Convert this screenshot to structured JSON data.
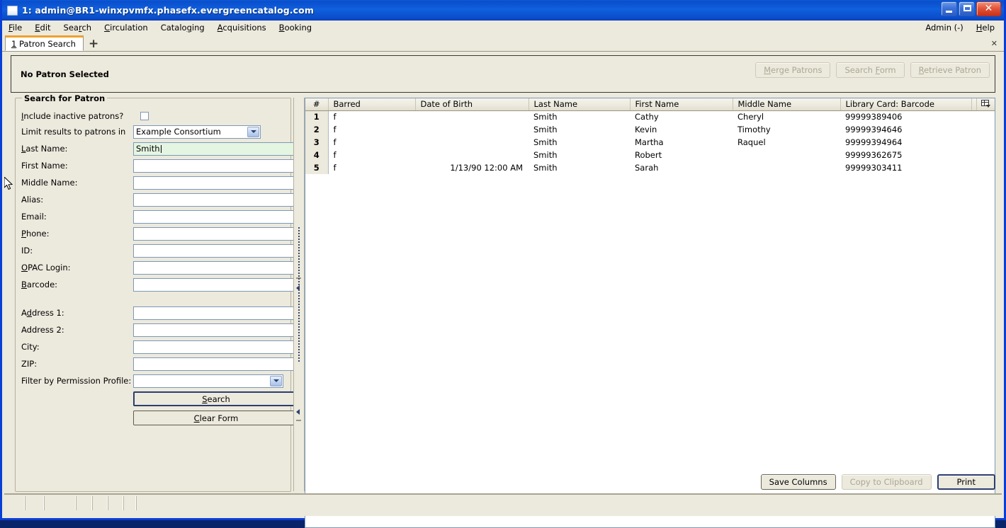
{
  "window": {
    "title": "1: admin@BR1-winxpvmfx.phasefx.evergreencatalog.com",
    "icon": "window-icon",
    "minimize": "minimize-icon",
    "maximize": "maximize-icon",
    "close": "✕"
  },
  "menubar": {
    "items": [
      {
        "label": "File",
        "accel": "F"
      },
      {
        "label": "Edit",
        "accel": "E"
      },
      {
        "label": "Search",
        "accel": "r"
      },
      {
        "label": "Circulation",
        "accel": "C"
      },
      {
        "label": "Cataloging",
        "accel": "g"
      },
      {
        "label": "Acquisitions",
        "accel": "A"
      },
      {
        "label": "Booking",
        "accel": "B"
      }
    ],
    "right": [
      {
        "label": "Admin (-)",
        "accel": ""
      },
      {
        "label": "Help",
        "accel": "H"
      }
    ]
  },
  "tabs": {
    "items": [
      {
        "index": "1",
        "label": "Patron Search"
      }
    ],
    "new_tab": "+",
    "close_tab": "✕"
  },
  "patron_bar": {
    "status": "No Patron Selected",
    "buttons": [
      {
        "label": "Merge Patrons",
        "accel": "M",
        "disabled": true
      },
      {
        "label": "Search Form",
        "accel": "F",
        "disabled": true
      },
      {
        "label": "Retrieve Patron",
        "accel": "R",
        "disabled": true
      }
    ]
  },
  "search_form": {
    "legend": "Search for Patron",
    "include_inactive": {
      "label": "Include inactive patrons?",
      "accel": "I",
      "checked": false
    },
    "limit_results": {
      "label": "Limit results to patrons in",
      "value": "Example Consortium"
    },
    "fields": [
      {
        "label": "Last Name:",
        "accel": "L",
        "value": "Smith",
        "focused": true
      },
      {
        "label": "First Name:",
        "accel": "",
        "value": "",
        "focused": false
      },
      {
        "label": "Middle Name:",
        "accel": "",
        "value": "",
        "focused": false
      },
      {
        "label": "Alias:",
        "accel": "",
        "value": "",
        "focused": false
      },
      {
        "label": "Email:",
        "accel": "",
        "value": "",
        "focused": false
      },
      {
        "label": "Phone:",
        "accel": "P",
        "value": "",
        "focused": false
      },
      {
        "label": "ID:",
        "accel": "",
        "value": "",
        "focused": false
      },
      {
        "label": "OPAC Login:",
        "accel": "O",
        "value": "",
        "focused": false
      },
      {
        "label": "Barcode:",
        "accel": "B",
        "value": "",
        "focused": false
      }
    ],
    "address_fields": [
      {
        "label": "Address 1:",
        "accel": "d",
        "value": ""
      },
      {
        "label": "Address 2:",
        "accel": "",
        "value": ""
      },
      {
        "label": "City:",
        "accel": "",
        "value": ""
      },
      {
        "label": "ZIP:",
        "accel": "",
        "value": ""
      }
    ],
    "permission_profile": {
      "label": "Filter by Permission Profile:",
      "value": ""
    },
    "search_button": {
      "label": "Search",
      "accel": "S"
    },
    "clear_button": {
      "label": "Clear Form",
      "accel": "C"
    }
  },
  "results": {
    "columns": [
      "#",
      "Barred",
      "Date of Birth",
      "Last Name",
      "First Name",
      "Middle Name",
      "Library Card: Barcode"
    ],
    "column_picker": "column-picker-icon",
    "rows": [
      {
        "num": "1",
        "barred": "f",
        "dob": "",
        "last": "Smith",
        "first": "Cathy",
        "middle": "Cheryl",
        "barcode": "99999389406"
      },
      {
        "num": "2",
        "barred": "f",
        "dob": "",
        "last": "Smith",
        "first": "Kevin",
        "middle": "Timothy",
        "barcode": "99999394646"
      },
      {
        "num": "3",
        "barred": "f",
        "dob": "",
        "last": "Smith",
        "first": "Martha",
        "middle": "Raquel",
        "barcode": "99999394964"
      },
      {
        "num": "4",
        "barred": "f",
        "dob": "",
        "last": "Smith",
        "first": "Robert",
        "middle": "",
        "barcode": "99999362675"
      },
      {
        "num": "5",
        "barred": "f",
        "dob": "1/13/90 12:00 AM",
        "last": "Smith",
        "first": "Sarah",
        "middle": "",
        "barcode": "99999303411"
      }
    ],
    "buttons": [
      {
        "label": "Save Columns",
        "disabled": false
      },
      {
        "label": "Copy to Clipboard",
        "disabled": true
      },
      {
        "label": "Print",
        "disabled": false
      }
    ]
  },
  "colors": {
    "titlebar": "#0A4ECB",
    "window_bg": "#ECE9DD",
    "field_border": "#7D99B5",
    "focused_field": "#E4F5E1",
    "tab_accent": "#F0A12E",
    "default_button_border": "#2C3E70"
  }
}
